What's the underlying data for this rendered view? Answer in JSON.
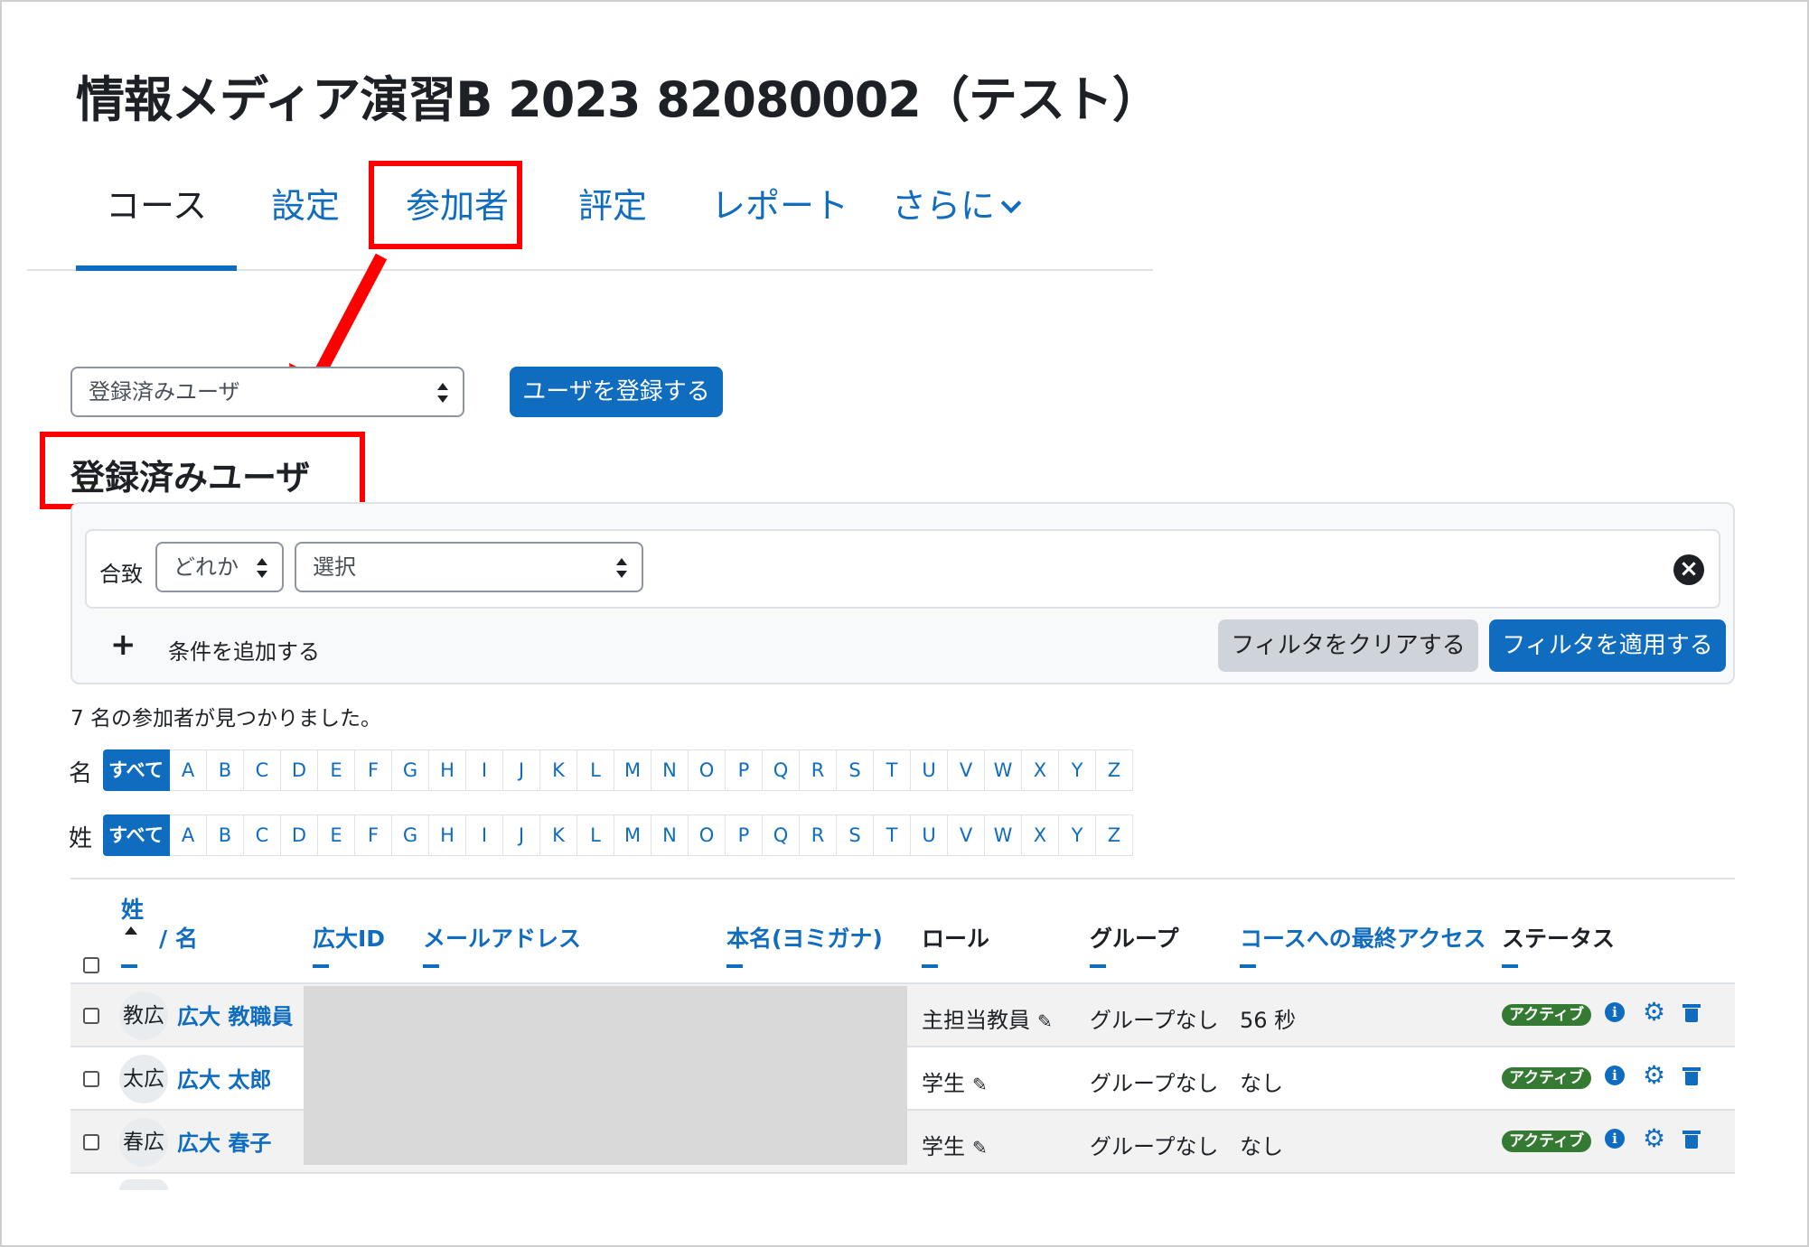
{
  "course": {
    "title": "情報メディア演習B 2023 82080002（テスト）"
  },
  "nav": {
    "tabs": [
      {
        "label": "コース",
        "active": true
      },
      {
        "label": "設定"
      },
      {
        "label": "参加者",
        "highlighted": true
      },
      {
        "label": "評定"
      },
      {
        "label": "レポート"
      },
      {
        "label": "さらに"
      }
    ]
  },
  "toolbar": {
    "view_select": "登録済みユーザ",
    "enrol_button": "ユーザを登録する"
  },
  "section": {
    "heading": "登録済みユーザ"
  },
  "filter": {
    "match_label": "合致",
    "match_value": "どれか",
    "type_value": "選択",
    "add_condition": "条件を追加する",
    "clear_button": "フィルタをクリアする",
    "apply_button": "フィルタを適用する"
  },
  "results": {
    "count_text": "7 名の参加者が見つかりました。"
  },
  "initials": {
    "firstname_label": "名",
    "lastname_label": "姓",
    "all_label": "すべて",
    "letters": [
      "A",
      "B",
      "C",
      "D",
      "E",
      "F",
      "G",
      "H",
      "I",
      "J",
      "K",
      "L",
      "M",
      "N",
      "O",
      "P",
      "Q",
      "R",
      "S",
      "T",
      "U",
      "V",
      "W",
      "X",
      "Y",
      "Z"
    ]
  },
  "table": {
    "headers": {
      "lastname": "姓",
      "firstname": "/ 名",
      "hirodai_id": "広大ID",
      "email": "メールアドレス",
      "realname": "本名(ヨミガナ)",
      "role": "ロール",
      "group": "グループ",
      "last_access": "コースへの最終アクセス",
      "status": "ステータス"
    },
    "rows": [
      {
        "avatar": "教広",
        "name": "広大 教職員",
        "role": "主担当教員",
        "group": "グループなし",
        "last_access": "56 秒",
        "status": "アクティブ"
      },
      {
        "avatar": "太広",
        "name": "広大 太郎",
        "role": "学生",
        "group": "グループなし",
        "last_access": "なし",
        "status": "アクティブ"
      },
      {
        "avatar": "春広",
        "name": "広大 春子",
        "role": "学生",
        "group": "グループなし",
        "last_access": "なし",
        "status": "アクティブ"
      }
    ]
  },
  "colors": {
    "primary": "#0f6cbf",
    "annotation": "#ff0000",
    "active_badge": "#357a32"
  }
}
